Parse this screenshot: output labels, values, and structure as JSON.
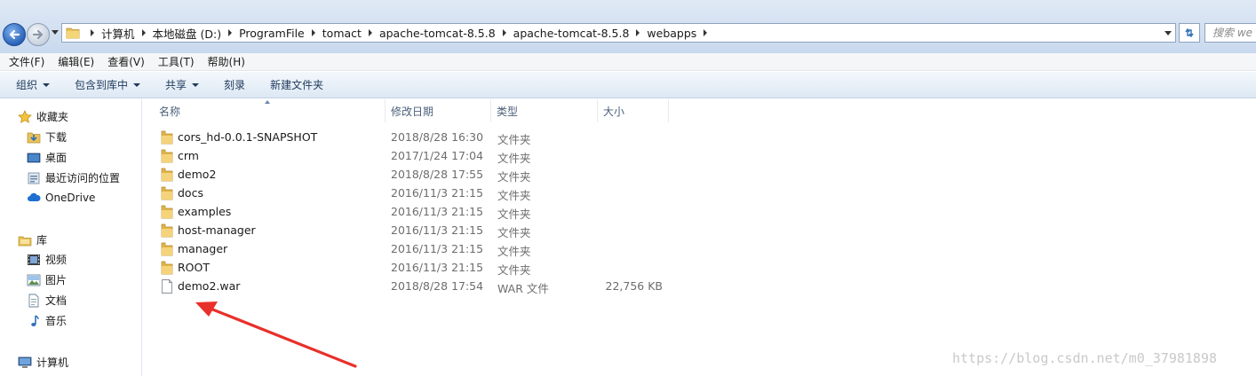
{
  "address_bar": {
    "breadcrumbs": [
      "计算机",
      "本地磁盘 (D:)",
      "ProgramFile",
      "tomact",
      "apache-tomcat-8.5.8",
      "apache-tomcat-8.5.8",
      "webapps"
    ],
    "search_placeholder": "搜索 we"
  },
  "menu": [
    "文件(F)",
    "编辑(E)",
    "查看(V)",
    "工具(T)",
    "帮助(H)"
  ],
  "toolbar": {
    "organize": "组织",
    "include_library": "包含到库中",
    "share": "共享",
    "burn": "刻录",
    "new_folder": "新建文件夹"
  },
  "nav_pane": {
    "favorites": "收藏夹",
    "favorites_items": [
      "下载",
      "桌面",
      "最近访问的位置"
    ],
    "onedrive": "OneDrive",
    "libraries": "库",
    "library_items": [
      "视频",
      "图片",
      "文档",
      "音乐"
    ],
    "computer": "计算机"
  },
  "columns": {
    "name": "名称",
    "modified": "修改日期",
    "type": "类型",
    "size": "大小"
  },
  "files": [
    {
      "name": "cors_hd-0.0.1-SNAPSHOT",
      "modified": "2018/8/28 16:30",
      "type": "文件夹",
      "size": "",
      "kind": "folder"
    },
    {
      "name": "crm",
      "modified": "2017/1/24 17:04",
      "type": "文件夹",
      "size": "",
      "kind": "folder"
    },
    {
      "name": "demo2",
      "modified": "2018/8/28 17:55",
      "type": "文件夹",
      "size": "",
      "kind": "folder"
    },
    {
      "name": "docs",
      "modified": "2016/11/3 21:15",
      "type": "文件夹",
      "size": "",
      "kind": "folder"
    },
    {
      "name": "examples",
      "modified": "2016/11/3 21:15",
      "type": "文件夹",
      "size": "",
      "kind": "folder"
    },
    {
      "name": "host-manager",
      "modified": "2016/11/3 21:15",
      "type": "文件夹",
      "size": "",
      "kind": "folder"
    },
    {
      "name": "manager",
      "modified": "2016/11/3 21:15",
      "type": "文件夹",
      "size": "",
      "kind": "folder"
    },
    {
      "name": "ROOT",
      "modified": "2016/11/3 21:15",
      "type": "文件夹",
      "size": "",
      "kind": "folder"
    },
    {
      "name": "demo2.war",
      "modified": "2018/8/28 17:54",
      "type": "WAR 文件",
      "size": "22,756 KB",
      "kind": "file"
    }
  ],
  "annotation_color": "#e8302a",
  "watermark": "https://blog.csdn.net/m0_37981898"
}
